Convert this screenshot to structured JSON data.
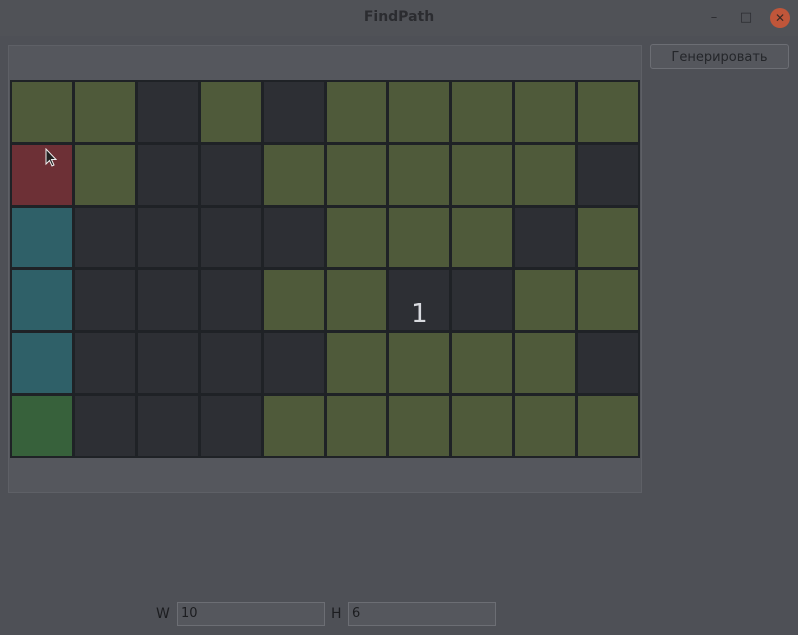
{
  "window": {
    "title": "FindPath"
  },
  "toolbar": {
    "generate_label": "Генерировать"
  },
  "size_inputs": {
    "w_label": "W",
    "w_value": "10",
    "h_label": "H",
    "h_value": "6"
  },
  "grid": {
    "columns": 10,
    "rows": 6,
    "cells": [
      [
        "open",
        "open",
        "wall",
        "open",
        "wall",
        "open",
        "open",
        "open",
        "open",
        "open"
      ],
      [
        "start",
        "open",
        "wall",
        "wall",
        "open",
        "open",
        "open",
        "open",
        "open",
        "wall"
      ],
      [
        "path",
        "wall",
        "wall",
        "wall",
        "wall",
        "open",
        "open",
        "open",
        "wall",
        "open"
      ],
      [
        "path",
        "wall",
        "wall",
        "wall",
        "open",
        "open",
        "wall",
        "wall",
        "open",
        "open"
      ],
      [
        "path",
        "wall",
        "wall",
        "wall",
        "wall",
        "open",
        "open",
        "open",
        "open",
        "wall"
      ],
      [
        "end",
        "wall",
        "wall",
        "wall",
        "open",
        "open",
        "open",
        "open",
        "open",
        "open"
      ]
    ],
    "label": {
      "row": 3,
      "col": 6,
      "text": "1"
    }
  },
  "colors": {
    "open": "#4f5a3a",
    "wall": "#2d2f34",
    "start": "#6d3036",
    "path": "#2f6068",
    "end": "#37613b"
  }
}
